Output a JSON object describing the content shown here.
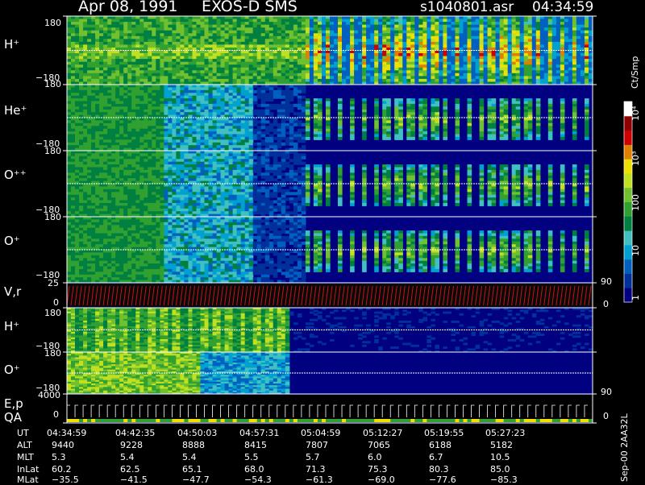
{
  "header": {
    "date": "Apr 08, 1991",
    "instrument": "EXOS-D SMS",
    "file": "s1040801.asr",
    "time": "04:34:59"
  },
  "colorbar": {
    "unit": "Ct/Smp",
    "ticks": [
      "1",
      "10",
      "100",
      "10³",
      "10⁴"
    ],
    "colors": [
      "#000080",
      "#00309a",
      "#0060c0",
      "#00a0d0",
      "#40c0c0",
      "#008040",
      "#30a030",
      "#70c030",
      "#c0e020",
      "#f0e000",
      "#e08000",
      "#d00000",
      "#900000",
      "#ffffff"
    ]
  },
  "panels": [
    {
      "label": "H⁺",
      "ytop": "180",
      "ybottom": "−180"
    },
    {
      "label": "He⁺",
      "ytop": "180",
      "ybottom": "−180"
    },
    {
      "label": "O⁺⁺",
      "ytop": "180",
      "ybottom": "−180"
    },
    {
      "label": "O⁺",
      "ytop": "180",
      "ybottom": "−180"
    },
    {
      "label": "V,r",
      "ytop": "25",
      "ybottom": "0",
      "rtop": "90",
      "rbottom": "0"
    },
    {
      "label": "H⁺",
      "ytop": "180",
      "ybottom": "−180"
    },
    {
      "label": "O⁺",
      "ytop": "180",
      "ybottom": "−180",
      "rbottom": "90"
    },
    {
      "label": "E,p",
      "label2": "QA",
      "ytop": "4000",
      "ybottom": "0",
      "rbottom": "0"
    }
  ],
  "footer": {
    "row_labels": [
      "UT",
      "ALT",
      "MLT",
      "InLat",
      "MLat"
    ],
    "columns": [
      [
        "04:34:59",
        "9440",
        "5.3",
        "60.2",
        "−35.5"
      ],
      [
        "04:42:35",
        "9228",
        "5.4",
        "62.5",
        "−41.5"
      ],
      [
        "04:50:03",
        "8888",
        "5.4",
        "65.1",
        "−47.7"
      ],
      [
        "04:57:31",
        "8415",
        "5.5",
        "68.0",
        "−54.3"
      ],
      [
        "05:04:59",
        "7807",
        "5.7",
        "71.3",
        "−61.3"
      ],
      [
        "05:12:27",
        "7065",
        "6.0",
        "75.3",
        "−69.0"
      ],
      [
        "05:19:55",
        "6188",
        "6.7",
        "80.3",
        "−77.6"
      ],
      [
        "05:27:23",
        "5182",
        "10.5",
        "85.0",
        "−85.3"
      ]
    ]
  },
  "side_note": "Sep-00  2AA32L",
  "chart_data": {
    "type": "heatmap",
    "title": "Apr 08, 1991   EXOS-D SMS",
    "x_ticks": [
      "04:34:59",
      "04:42:35",
      "04:50:03",
      "04:57:31",
      "05:04:59",
      "05:12:27",
      "05:19:55",
      "05:27:23"
    ],
    "color_scale": "log",
    "color_range": [
      1,
      10000
    ],
    "color_unit": "Ct/Smp",
    "series": [
      {
        "name": "H⁺",
        "ylim": [
          -180,
          180
        ]
      },
      {
        "name": "He⁺",
        "ylim": [
          -180,
          180
        ]
      },
      {
        "name": "O⁺⁺",
        "ylim": [
          -180,
          180
        ]
      },
      {
        "name": "O⁺",
        "ylim": [
          -180,
          180
        ]
      },
      {
        "name": "V,r",
        "ylim": [
          0,
          25
        ]
      },
      {
        "name": "H⁺",
        "ylim": [
          -180,
          180
        ]
      },
      {
        "name": "O⁺",
        "ylim": [
          -180,
          180
        ]
      },
      {
        "name": "E,p",
        "ylim": [
          0,
          4000
        ]
      }
    ]
  }
}
